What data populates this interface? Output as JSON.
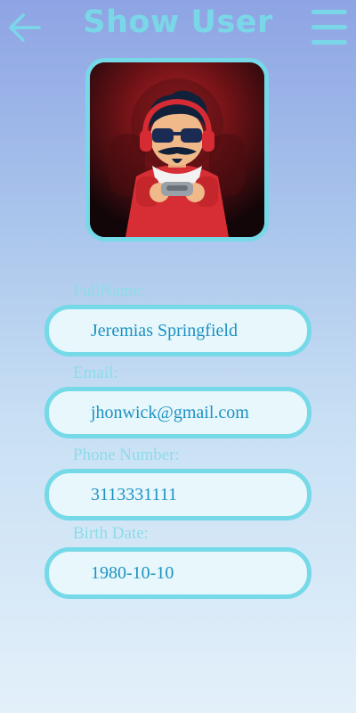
{
  "header": {
    "title": "Show User",
    "back_icon": "arrow-left-icon",
    "menu_icon": "hamburger-menu-icon"
  },
  "avatar": {
    "image": "gamer-mascot-avatar"
  },
  "fields": {
    "full_name": {
      "label": "FullName:",
      "value": "Jeremias Springfield"
    },
    "email": {
      "label": "Email:",
      "value": "jhonwick@gmail.com"
    },
    "phone": {
      "label": "Phone Number:",
      "value": "3113331111"
    },
    "birth_date": {
      "label": "Birth Date:",
      "value": "1980-10-10"
    }
  },
  "colors": {
    "accent": "#76d9e8",
    "title": "#7ad7e8",
    "value_text": "#1d92c2",
    "field_fill": "#e7f7fc"
  }
}
